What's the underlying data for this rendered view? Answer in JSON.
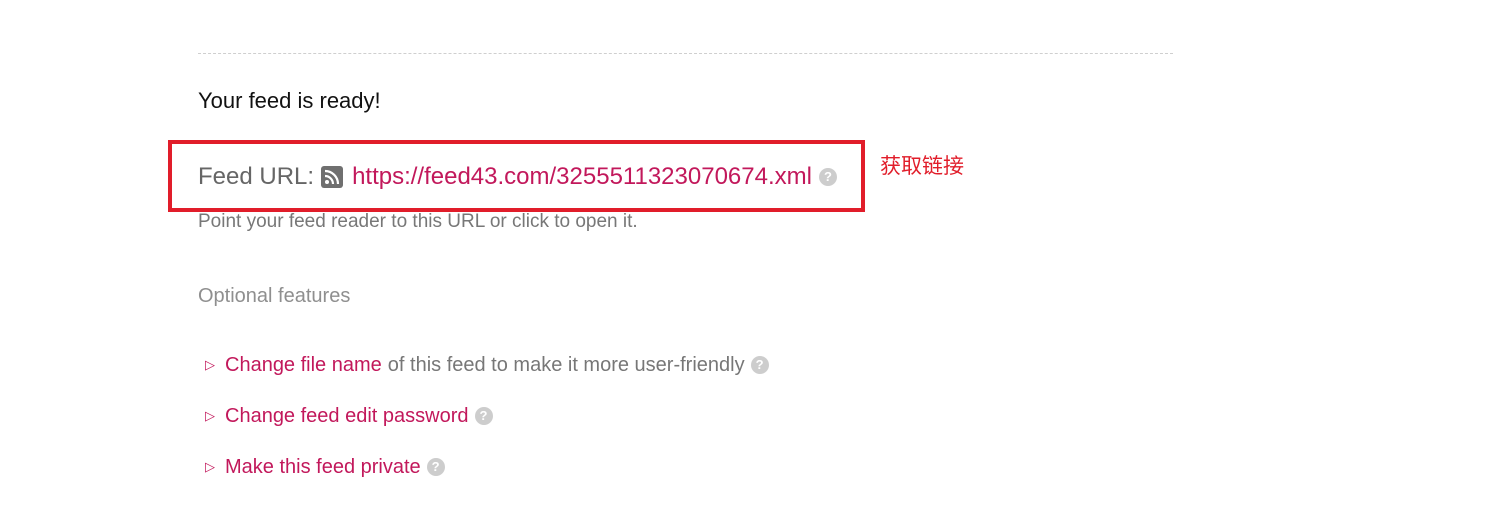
{
  "ready_title": "Your feed is ready!",
  "feed": {
    "label": "Feed URL:",
    "url": "https://feed43.com/3255511323070674.xml",
    "help": "?",
    "hint": "Point your feed reader to this URL or click to open it."
  },
  "annotation": "获取链接",
  "optional": {
    "title": "Optional features",
    "items": [
      {
        "marker": "▷",
        "link": "Change file name",
        "rest": "of this feed to make it more user-friendly",
        "help": "?"
      },
      {
        "marker": "▷",
        "link": "Change feed edit password",
        "rest": "",
        "help": "?"
      },
      {
        "marker": "▷",
        "link": "Make this feed private",
        "rest": "",
        "help": "?"
      }
    ]
  },
  "colors": {
    "link": "#c2185b",
    "annotation": "#e11d2a",
    "muted_text": "#777777"
  },
  "icons": [
    "rss-icon",
    "help-icon",
    "expand-triangle-icon"
  ]
}
